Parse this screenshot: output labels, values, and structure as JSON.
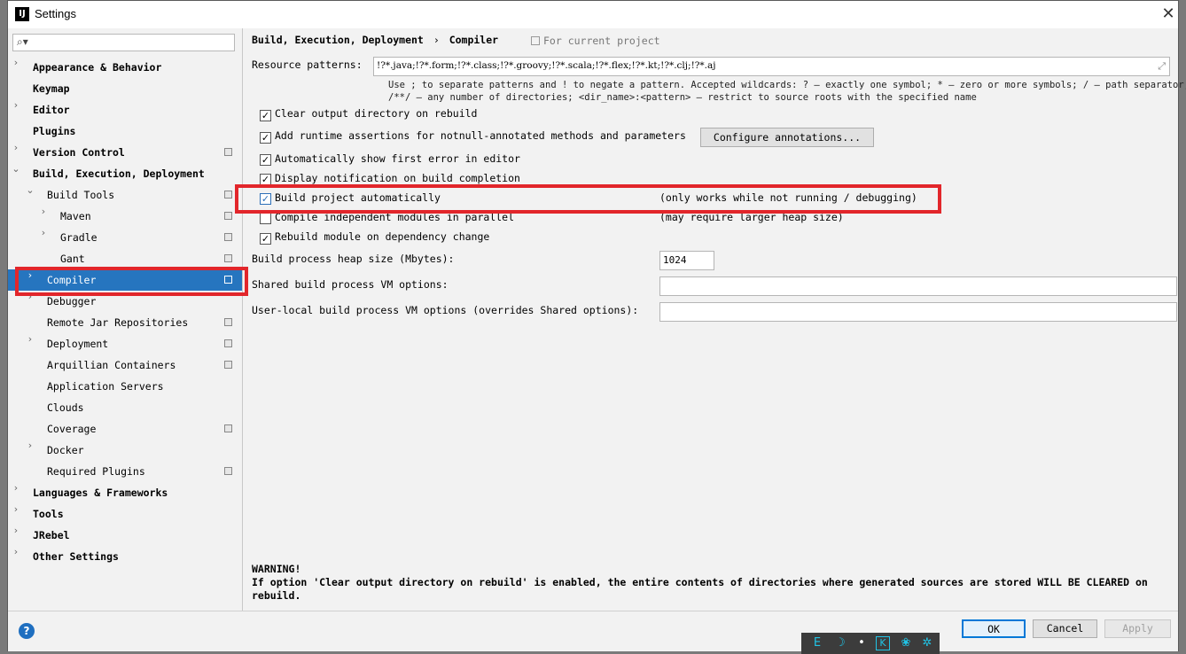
{
  "window": {
    "title": "Settings",
    "app_icon": "IJ"
  },
  "search": {
    "placeholder": ""
  },
  "tree": [
    {
      "label": "Appearance & Behavior",
      "level": 0,
      "arrow": "›",
      "bold": true,
      "proj": false
    },
    {
      "label": "Keymap",
      "level": 0,
      "arrow": "",
      "bold": true,
      "proj": false
    },
    {
      "label": "Editor",
      "level": 0,
      "arrow": "›",
      "bold": true,
      "proj": false
    },
    {
      "label": "Plugins",
      "level": 0,
      "arrow": "",
      "bold": true,
      "proj": false
    },
    {
      "label": "Version Control",
      "level": 0,
      "arrow": "›",
      "bold": true,
      "proj": true
    },
    {
      "label": "Build, Execution, Deployment",
      "level": 0,
      "arrow": "⌄",
      "bold": true,
      "proj": false
    },
    {
      "label": "Build Tools",
      "level": 1,
      "arrow": "⌄",
      "bold": false,
      "proj": true
    },
    {
      "label": "Maven",
      "level": 2,
      "arrow": "›",
      "bold": false,
      "proj": true
    },
    {
      "label": "Gradle",
      "level": 2,
      "arrow": "›",
      "bold": false,
      "proj": true
    },
    {
      "label": "Gant",
      "level": 2,
      "arrow": "",
      "bold": false,
      "proj": true
    },
    {
      "label": "Compiler",
      "level": 1,
      "arrow": "›",
      "bold": false,
      "proj": true,
      "selected": true
    },
    {
      "label": "Debugger",
      "level": 1,
      "arrow": "›",
      "bold": false,
      "proj": false
    },
    {
      "label": "Remote Jar Repositories",
      "level": 1,
      "arrow": "",
      "bold": false,
      "proj": true
    },
    {
      "label": "Deployment",
      "level": 1,
      "arrow": "›",
      "bold": false,
      "proj": true
    },
    {
      "label": "Arquillian Containers",
      "level": 1,
      "arrow": "",
      "bold": false,
      "proj": true
    },
    {
      "label": "Application Servers",
      "level": 1,
      "arrow": "",
      "bold": false,
      "proj": false
    },
    {
      "label": "Clouds",
      "level": 1,
      "arrow": "",
      "bold": false,
      "proj": false
    },
    {
      "label": "Coverage",
      "level": 1,
      "arrow": "",
      "bold": false,
      "proj": true
    },
    {
      "label": "Docker",
      "level": 1,
      "arrow": "›",
      "bold": false,
      "proj": false
    },
    {
      "label": "Required Plugins",
      "level": 1,
      "arrow": "",
      "bold": false,
      "proj": true
    },
    {
      "label": "Languages & Frameworks",
      "level": 0,
      "arrow": "›",
      "bold": true,
      "proj": false
    },
    {
      "label": "Tools",
      "level": 0,
      "arrow": "›",
      "bold": true,
      "proj": false
    },
    {
      "label": "JRebel",
      "level": 0,
      "arrow": "›",
      "bold": true,
      "proj": false
    },
    {
      "label": "Other Settings",
      "level": 0,
      "arrow": "›",
      "bold": true,
      "proj": false
    }
  ],
  "breadcrumb": {
    "parent": "Build, Execution, Deployment",
    "separator": "›",
    "current": "Compiler",
    "scope": "For current project"
  },
  "resource_patterns": {
    "label": "Resource patterns:",
    "value": "!?*.java;!?*.form;!?*.class;!?*.groovy;!?*.scala;!?*.flex;!?*.kt;!?*.clj;!?*.aj",
    "hint_line1": "Use ; to separate patterns and ! to negate a pattern. Accepted wildcards: ? — exactly one symbol; * — zero or more symbols; / — path separator;",
    "hint_line2": "/**/ — any number of directories; <dir_name>:<pattern> — restrict to source roots with the specified name"
  },
  "options": {
    "clear_output": {
      "label": "Clear output directory on rebuild",
      "checked": true
    },
    "runtime_assertions": {
      "label": "Add runtime assertions for notnull-annotated methods and parameters",
      "checked": true,
      "button": "Configure annotations..."
    },
    "show_first_error": {
      "label": "Automatically show first error in editor",
      "checked": true
    },
    "display_notification": {
      "label": "Display notification on build completion",
      "checked": true
    },
    "build_automatically": {
      "label": "Build project automatically",
      "checked": true,
      "note": "(only works while not running / debugging)"
    },
    "compile_parallel": {
      "label": "Compile independent modules in parallel",
      "checked": false,
      "note": "(may require larger heap size)"
    },
    "rebuild_on_dependency": {
      "label": "Rebuild module on dependency change",
      "checked": true
    }
  },
  "fields": {
    "heap_label": "Build process heap size (Mbytes):",
    "heap_value": "1024",
    "shared_vm_label": "Shared build process VM options:",
    "shared_vm_value": "",
    "user_vm_label": "User-local build process VM options (overrides Shared options):",
    "user_vm_value": ""
  },
  "warning": {
    "title": "WARNING!",
    "line1": "If option 'Clear output directory on rebuild' is enabled, the entire contents of directories where generated sources are stored WILL BE CLEARED on",
    "line2": "rebuild."
  },
  "footer": {
    "ok": "OK",
    "cancel": "Cancel",
    "apply": "Apply",
    "help": "?"
  },
  "taskbar": [
    "E",
    "☽",
    "•",
    "K",
    "❀",
    "✲"
  ],
  "colors": {
    "selection": "#2675bf",
    "highlight_box": "#e2262b"
  }
}
